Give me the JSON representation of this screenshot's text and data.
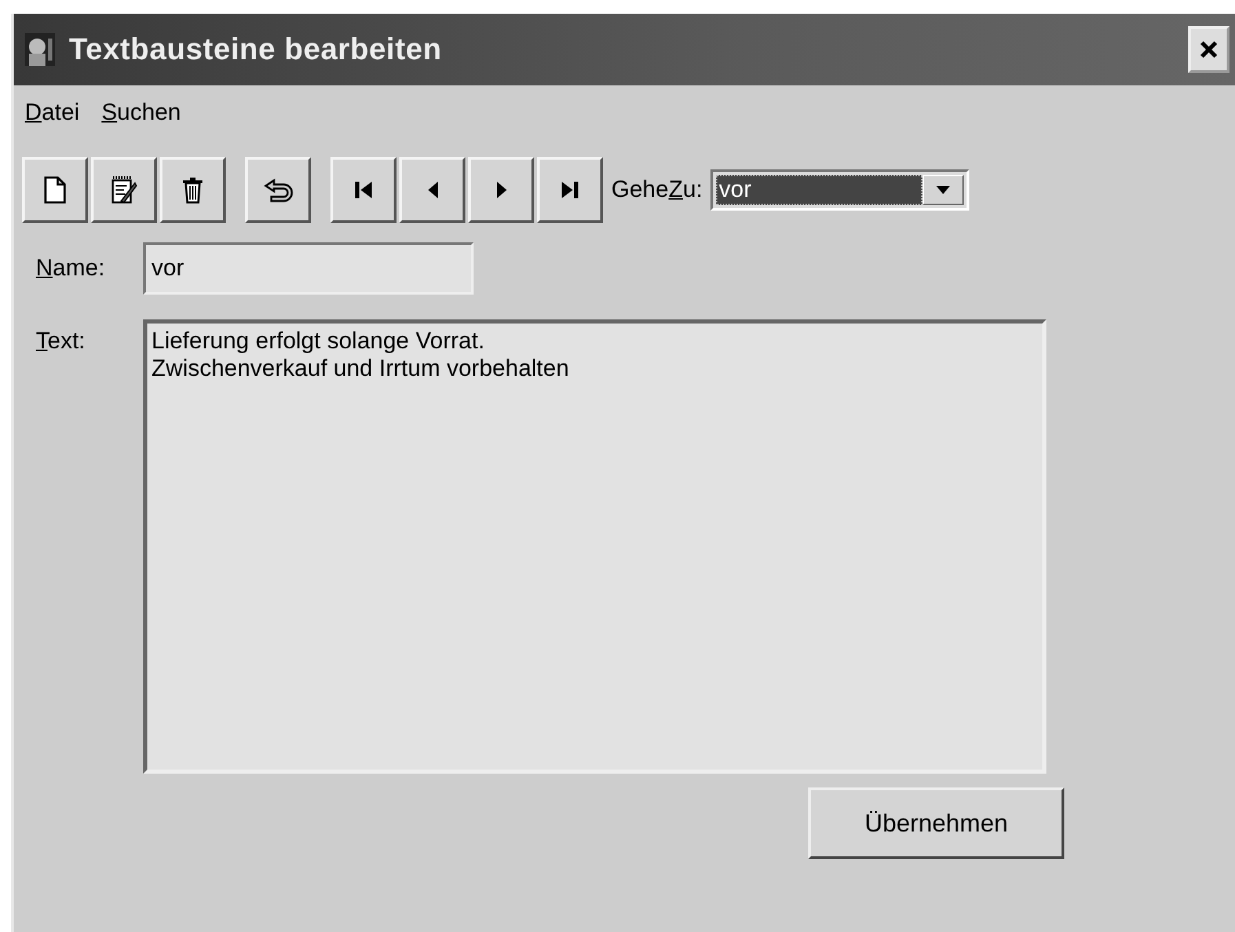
{
  "window": {
    "title": "Textbausteine bearbeiten"
  },
  "menu": [
    {
      "key": "D",
      "post": "atei"
    },
    {
      "key": "S",
      "post": "uchen"
    }
  ],
  "toolbar": [
    {
      "kind": "new"
    },
    {
      "kind": "edit"
    },
    {
      "kind": "delete"
    },
    {
      "kind": "undo"
    },
    {
      "kind": "first"
    },
    {
      "kind": "prev"
    },
    {
      "kind": "next"
    },
    {
      "kind": "last"
    }
  ],
  "goto": {
    "label": {
      "pre": "Gehe",
      "key": "Z",
      "post": "u:"
    },
    "value": "vor",
    "selected": true
  },
  "name": {
    "label": {
      "key": "N",
      "post": "ame:"
    },
    "value": "vor"
  },
  "text": {
    "label": {
      "key": "T",
      "post": "ext:"
    },
    "lines": [
      "Lieferung erfolgt solange Vorrat.",
      "Zwischenverkauf und Irrtum vorbehalten"
    ]
  },
  "buttons": [
    "Übernehmen"
  ]
}
